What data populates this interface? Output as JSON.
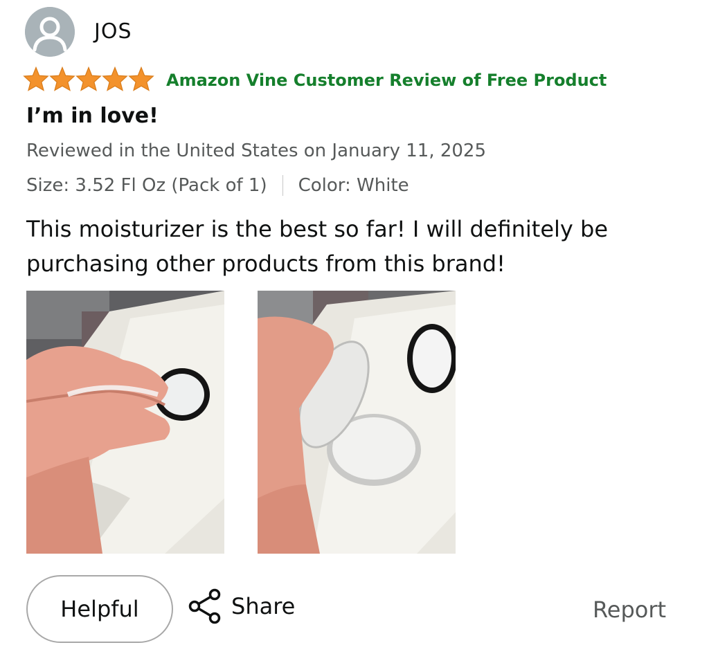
{
  "reviewer": {
    "name": "JOS",
    "avatar_icon": "default-user-avatar"
  },
  "rating": {
    "value": 5,
    "max": 5,
    "star_color": "#f3922c"
  },
  "vine_label": "Amazon Vine Customer Review of Free Product",
  "vine_color": "#157f2c",
  "review": {
    "title": "I’m in love!",
    "date_line": "Reviewed in the United States on January 11, 2025",
    "size": "Size: 3.52 Fl Oz (Pack of 1)",
    "color": "Color: White",
    "body": "This moisturizer is the best so far! I will definitely be purchasing other products from this brand!"
  },
  "actions": {
    "helpful_label": "Helpful",
    "share_label": "Share",
    "share_icon": "share-icon",
    "report_label": "Report"
  }
}
